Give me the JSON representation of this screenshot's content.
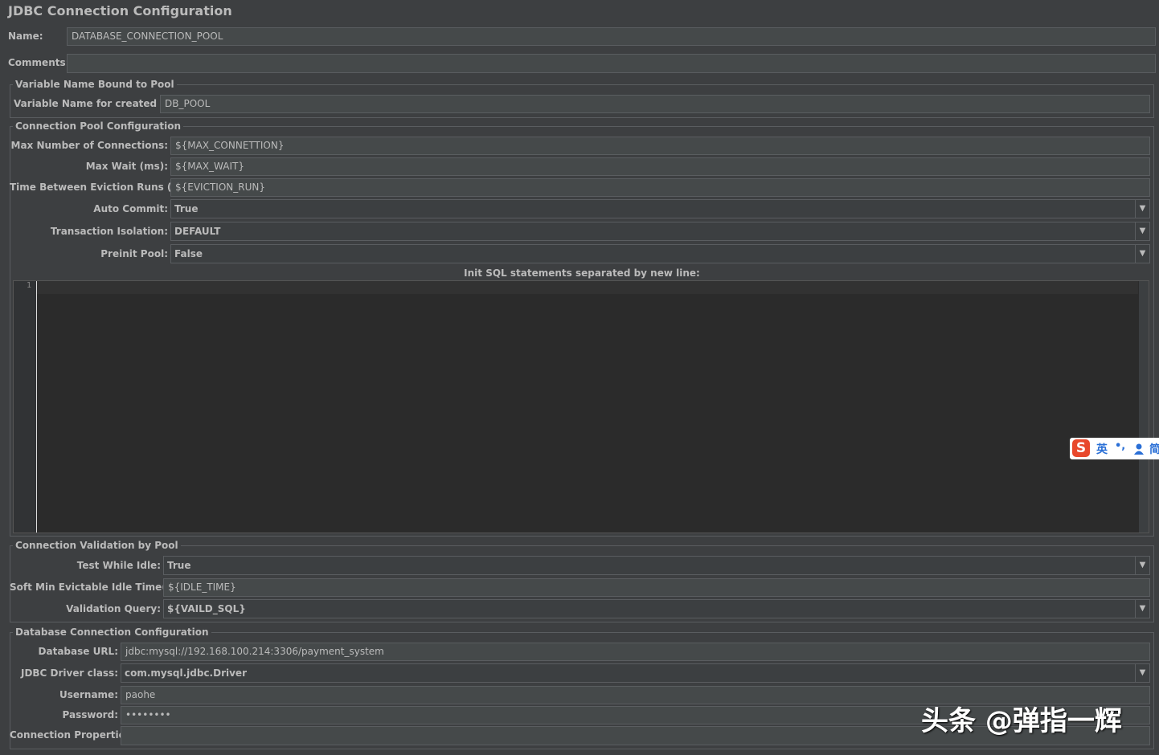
{
  "title": "JDBC Connection Configuration",
  "general": {
    "name_label": "Name:",
    "name_value": "DATABASE_CONNECTION_POOL",
    "comments_label": "Comments:",
    "comments_value": ""
  },
  "variable_section": {
    "legend": "Variable Name Bound to Pool",
    "var_label": "Variable Name for created pool:",
    "var_value": "DB_POOL"
  },
  "pool_section": {
    "legend": "Connection Pool Configuration",
    "max_conn_label": "Max Number of Connections:",
    "max_conn_value": "${MAX_CONNETTION}",
    "max_wait_label": "Max Wait (ms):",
    "max_wait_value": "${MAX_WAIT}",
    "eviction_label": "Time Between Eviction Runs (ms):",
    "eviction_value": "${EVICTION_RUN}",
    "auto_commit_label": "Auto Commit:",
    "auto_commit_value": "True",
    "isolation_label": "Transaction Isolation:",
    "isolation_value": "DEFAULT",
    "preinit_label": "Preinit Pool:",
    "preinit_value": "False",
    "init_sql_label": "Init SQL statements separated by new line:",
    "line_number": "1"
  },
  "validation_section": {
    "legend": "Connection Validation by Pool",
    "test_idle_label": "Test While Idle:",
    "test_idle_value": "True",
    "soft_min_label": "Soft Min Evictable Idle Time(ms):",
    "soft_min_value": "${IDLE_TIME}",
    "query_label": "Validation Query:",
    "query_value": "${VAILD_SQL}"
  },
  "db_section": {
    "legend": "Database Connection Configuration",
    "url_label": "Database URL:",
    "url_value": "jdbc:mysql://192.168.100.214:3306/payment_system",
    "driver_label": "JDBC Driver class:",
    "driver_value": "com.mysql.jdbc.Driver",
    "username_label": "Username:",
    "username_value": "paohe",
    "password_label": "Password:",
    "password_value": "••••••••",
    "props_label": "Connection Properties:",
    "props_value": ""
  },
  "ime": {
    "logo": "S",
    "lang": "英",
    "punct": "•,",
    "mode": "简"
  },
  "watermark": "头条 @弹指一辉",
  "colors": {
    "background": "#3d3f41",
    "field": "#45494a",
    "editor": "#2b2b2b",
    "text": "#bbbbbb",
    "ime_logo": "#e8482c",
    "ime_blue": "#2a6fd6"
  },
  "icons": {
    "combo_arrow": "triangle-down-icon",
    "ime_user": "user-icon"
  }
}
